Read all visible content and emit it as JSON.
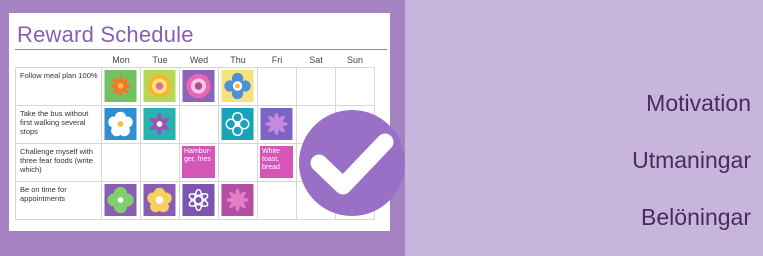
{
  "card": {
    "title": "Reward Schedule"
  },
  "schedule": {
    "days": [
      "Mon",
      "Tue",
      "Wed",
      "Thu",
      "Fri",
      "Sat",
      "Sun"
    ],
    "rows": [
      {
        "task": "Follow meal plan 100%"
      },
      {
        "task": "Take the bus without first walking several stops"
      },
      {
        "task": "Challenge myself with three fear foods (write which)"
      },
      {
        "task": "Be on time for appointments"
      }
    ],
    "notes": {
      "wed": "Hambur-ger, fries",
      "fri": "White toast, bread"
    }
  },
  "side_words": [
    "Motivation",
    "Utmaningar",
    "Belöningar"
  ],
  "colors": {
    "background": "#a583c2",
    "right_panel": "#c7b5dc",
    "title": "#8a5fb0",
    "note": "#d656b8",
    "badge": "#9a6fc6"
  }
}
